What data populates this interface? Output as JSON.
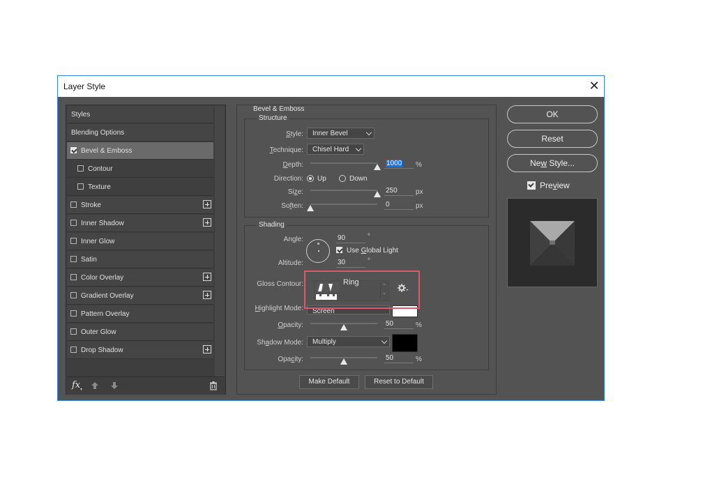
{
  "dialog": {
    "title": "Layer Style"
  },
  "styles_list": [
    {
      "label": "Styles",
      "checkbox": false,
      "checked": false,
      "sub": false,
      "plus": false,
      "selected": false
    },
    {
      "label": "Blending Options",
      "checkbox": false,
      "checked": false,
      "sub": false,
      "plus": false,
      "selected": false
    },
    {
      "label": "Bevel & Emboss",
      "checkbox": true,
      "checked": true,
      "sub": false,
      "plus": false,
      "selected": true
    },
    {
      "label": "Contour",
      "checkbox": true,
      "checked": false,
      "sub": true,
      "plus": false,
      "selected": false
    },
    {
      "label": "Texture",
      "checkbox": true,
      "checked": false,
      "sub": true,
      "plus": false,
      "selected": false
    },
    {
      "label": "Stroke",
      "checkbox": true,
      "checked": false,
      "sub": false,
      "plus": true,
      "selected": false
    },
    {
      "label": "Inner Shadow",
      "checkbox": true,
      "checked": false,
      "sub": false,
      "plus": true,
      "selected": false
    },
    {
      "label": "Inner Glow",
      "checkbox": true,
      "checked": false,
      "sub": false,
      "plus": false,
      "selected": false
    },
    {
      "label": "Satin",
      "checkbox": true,
      "checked": false,
      "sub": false,
      "plus": false,
      "selected": false
    },
    {
      "label": "Color Overlay",
      "checkbox": true,
      "checked": false,
      "sub": false,
      "plus": true,
      "selected": false
    },
    {
      "label": "Gradient Overlay",
      "checkbox": true,
      "checked": false,
      "sub": false,
      "plus": true,
      "selected": false
    },
    {
      "label": "Pattern Overlay",
      "checkbox": true,
      "checked": false,
      "sub": false,
      "plus": false,
      "selected": false
    },
    {
      "label": "Outer Glow",
      "checkbox": true,
      "checked": false,
      "sub": false,
      "plus": false,
      "selected": false
    },
    {
      "label": "Drop Shadow",
      "checkbox": true,
      "checked": false,
      "sub": false,
      "plus": true,
      "selected": false
    }
  ],
  "footer": {
    "fx": "fx",
    "up_icon": "arrow-up-icon",
    "down_icon": "arrow-down-icon",
    "trash_icon": "trash-icon"
  },
  "bevel": {
    "section_title": "Bevel & Emboss",
    "structure_title": "Structure",
    "style_label": "Style:",
    "style_value": "Inner Bevel",
    "technique_label": "Technique:",
    "technique_value": "Chisel Hard",
    "depth_label": "Depth:",
    "depth_value": "1000",
    "depth_unit": "%",
    "depth_fraction": 1.0,
    "direction_label": "Direction:",
    "direction_up": "Up",
    "direction_down": "Down",
    "direction_selected": "Up",
    "size_label": "Size:",
    "size_value": "250",
    "size_unit": "px",
    "size_fraction": 1.0,
    "soften_label": "Soften:",
    "soften_value": "0",
    "soften_unit": "px",
    "soften_fraction": 0.0
  },
  "shading": {
    "title": "Shading",
    "angle_label": "Angle:",
    "angle_value": "90",
    "degree": "°",
    "use_global_light": "Use Global Light",
    "use_global_light_checked": true,
    "altitude_label": "Altitude:",
    "altitude_value": "30",
    "gloss_contour_label": "Gloss Contour:",
    "gloss_contour_value": "Ring",
    "highlight_mode_label": "Highlight Mode:",
    "highlight_mode_value": "Screen",
    "highlight_color": "#ffffff",
    "highlight_opacity_label": "Opacity:",
    "highlight_opacity_value": "50",
    "highlight_opacity_fraction": 0.5,
    "shadow_mode_label": "Shadow Mode:",
    "shadow_mode_value": "Multiply",
    "shadow_color": "#000000",
    "shadow_opacity_label": "Opacity:",
    "shadow_opacity_value": "50",
    "shadow_opacity_fraction": 0.5,
    "percent": "%"
  },
  "defaults": {
    "make_default": "Make Default",
    "reset_to_default": "Reset to Default"
  },
  "actions": {
    "ok": "OK",
    "reset": "Reset",
    "new_style": "New Style...",
    "preview": "Preview",
    "preview_checked": true
  },
  "highlight_box_color": "#e0576b",
  "accent_color": "#1473e6"
}
